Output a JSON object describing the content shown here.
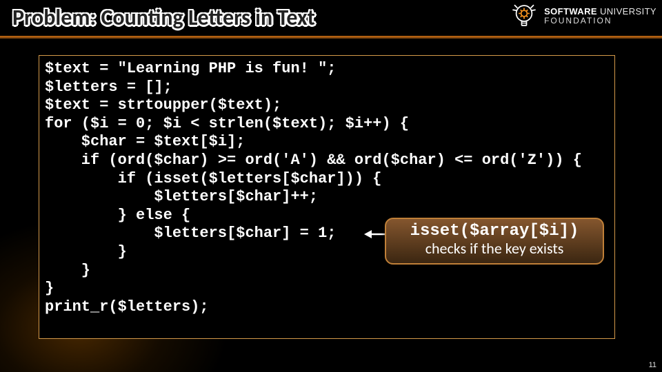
{
  "title": "Problem: Counting Letters in Text",
  "logo": {
    "line1_bold": "SOFTWARE",
    "line1_thin": "UNIVERSITY",
    "line2": "FOUNDATION"
  },
  "code": "$text = \"Learning PHP is fun! \";\n$letters = [];\n$text = strtoupper($text);\nfor ($i = 0; $i < strlen($text); $i++) {\n    $char = $text[$i];\n    if (ord($char) >= ord('A') && ord($char) <= ord('Z')) {\n        if (isset($letters[$char])) {\n            $letters[$char]++;\n        } else {\n            $letters[$char] = 1;\n        }\n    }\n}\nprint_r($letters);",
  "callout": {
    "code": "isset($array[$i])",
    "text": "checks if the key exists"
  },
  "page": "11"
}
